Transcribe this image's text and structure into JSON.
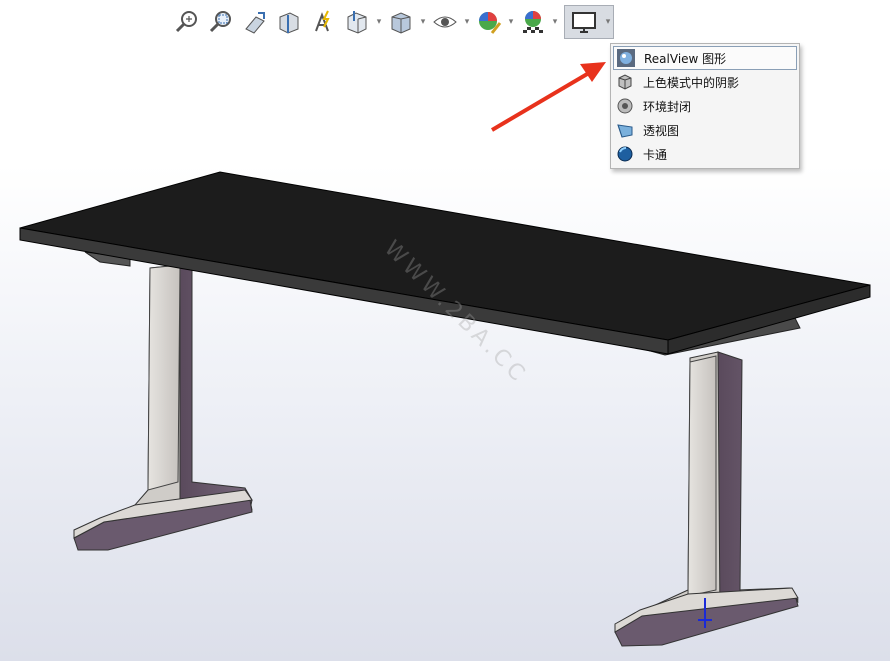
{
  "toolbar": {
    "buttons": [
      {
        "name": "zoom-to-fit-icon"
      },
      {
        "name": "zoom-to-area-icon"
      },
      {
        "name": "previous-view-icon"
      },
      {
        "name": "section-view-icon"
      },
      {
        "name": "dynamic-annotation-views-icon"
      },
      {
        "name": "view-orientation-icon"
      },
      {
        "name": "display-style-icon"
      },
      {
        "name": "hide-show-items-icon"
      },
      {
        "name": "edit-appearance-icon"
      },
      {
        "name": "apply-scene-icon"
      },
      {
        "name": "view-settings-icon"
      }
    ]
  },
  "view_settings_menu": {
    "items": [
      {
        "label": "RealView 图形",
        "icon": "realview-sphere-icon"
      },
      {
        "label": "上色模式中的阴影",
        "icon": "shadow-cube-icon"
      },
      {
        "label": "环境封闭",
        "icon": "ambient-occlusion-icon"
      },
      {
        "label": "透视图",
        "icon": "perspective-icon"
      },
      {
        "label": "卡通",
        "icon": "cartoon-sphere-icon"
      }
    ]
  },
  "watermark": "WWW.2BA.CC",
  "colors": {
    "annotation_arrow": "#e8321c",
    "table_top": "#1c1c1c",
    "legs": "#d8d4d0"
  }
}
